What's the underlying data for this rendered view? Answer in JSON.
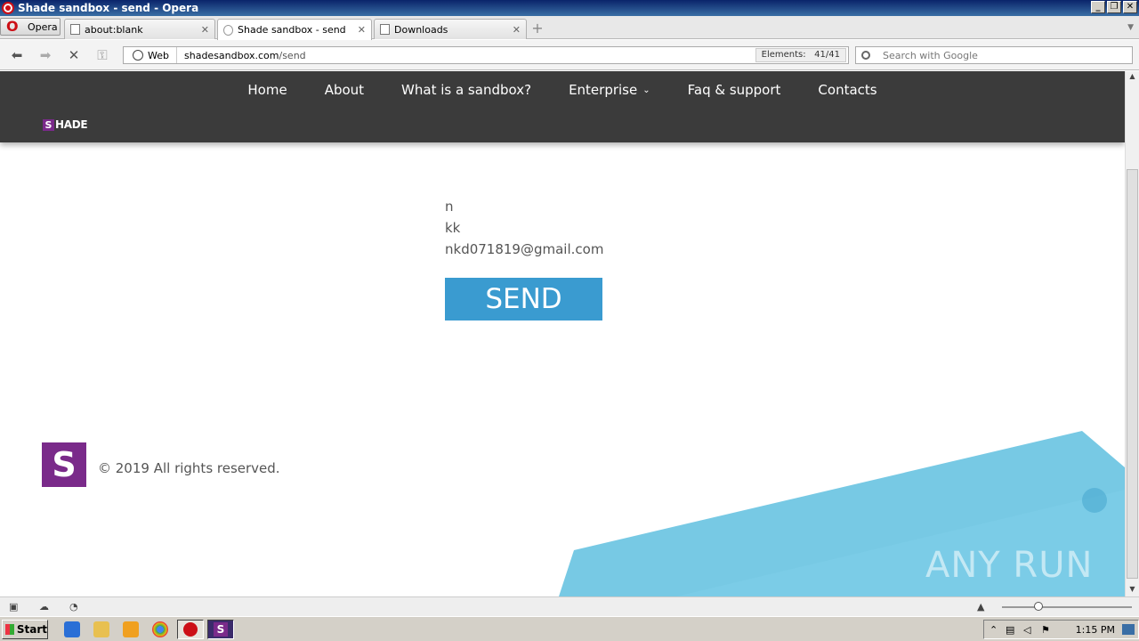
{
  "window": {
    "title": "Shade sandbox - send - Opera"
  },
  "browser": {
    "menu_label": "Opera",
    "tabs": [
      {
        "label": "about:blank",
        "active": false
      },
      {
        "label": "Shade sandbox - send",
        "active": true
      },
      {
        "label": "Downloads",
        "active": false
      }
    ],
    "address": {
      "scheme_label": "Web",
      "domain": "shadesandbox.com",
      "path": "/send",
      "elements_label": "Elements:",
      "elements_value": "41/41"
    },
    "search_placeholder": "Search with Google"
  },
  "site": {
    "nav": [
      "Home",
      "About",
      "What is a sandbox?",
      "Enterprise",
      "Faq & support",
      "Contacts"
    ],
    "logo_letter": "S",
    "logo_word": "HADE",
    "form_values": [
      "n",
      "kk",
      "nkd071819@gmail.com"
    ],
    "send_label": "SEND",
    "footer_logo_letter": "S",
    "footer_copyright": "© 2019 All rights reserved.",
    "watermark": "ANY RUN"
  },
  "taskbar": {
    "start_label": "Start",
    "clock": "1:15 PM"
  },
  "colors": {
    "header_bg": "#3b3b3b",
    "brand_purple": "#7a2a8a",
    "send_blue": "#3a9bd0",
    "wave_blue": "#5fc0df"
  }
}
